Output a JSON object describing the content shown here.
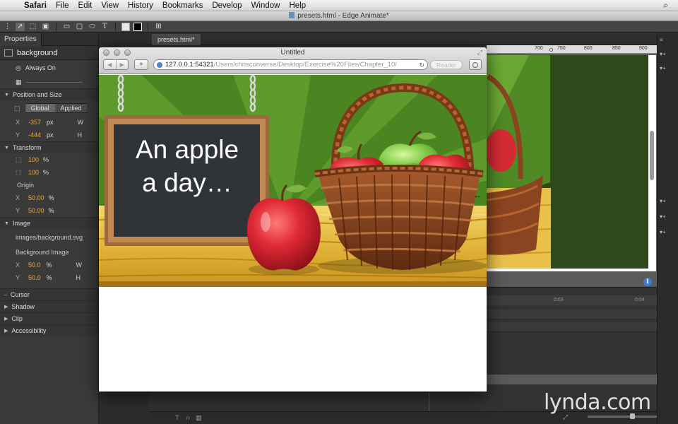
{
  "menubar": {
    "app": "Safari",
    "items": [
      "File",
      "Edit",
      "View",
      "History",
      "Bookmarks",
      "Develop",
      "Window",
      "Help"
    ]
  },
  "app_window": {
    "title": "presets.html - Edge Animate*"
  },
  "document": {
    "tab": "presets.html*"
  },
  "properties": {
    "panel_title": "Properties",
    "element_name": "background",
    "display": "Always On",
    "position_size": {
      "title": "Position and Size",
      "modes": [
        "Global",
        "Applied"
      ],
      "x": "-357",
      "y": "-444",
      "unit": "px",
      "w_label": "W",
      "h_label": "H"
    },
    "transform": {
      "title": "Transform",
      "scale_x": "100",
      "scale_y": "100",
      "unit": "%",
      "origin_label": "Origin",
      "origin_x": "50.00",
      "origin_y": "50.00"
    },
    "image": {
      "title": "Image",
      "path": "images/background.svg",
      "bg_label": "Background Image",
      "x": "50.0",
      "y": "50.0",
      "unit": "%",
      "w_label": "W",
      "h_label": "H"
    },
    "sections": [
      "Cursor",
      "Shadow",
      "Clip",
      "Accessibility"
    ]
  },
  "ruler": {
    "ticks": [
      "700",
      "750",
      "800",
      "850",
      "900"
    ]
  },
  "timeline": {
    "ticks": [
      "0:03",
      "0:04"
    ]
  },
  "browser": {
    "title": "Untitled",
    "url_host": "127.0.0.1:54321",
    "url_path": "/Users/chrisconverse/Desktop/Exercise%20Files/Chapter_10/",
    "reader": "Reader",
    "slogan_line1": "An apple",
    "slogan_line2": "a day…"
  },
  "watermark": "lynda.com",
  "colors": {
    "accent_value": "#e8a93a",
    "scene_green": "#5f9a2c",
    "wood": "#e9c14a",
    "apple_red": "#d42a34",
    "apple_green": "#7cc84a",
    "basket": "#8a4520"
  }
}
